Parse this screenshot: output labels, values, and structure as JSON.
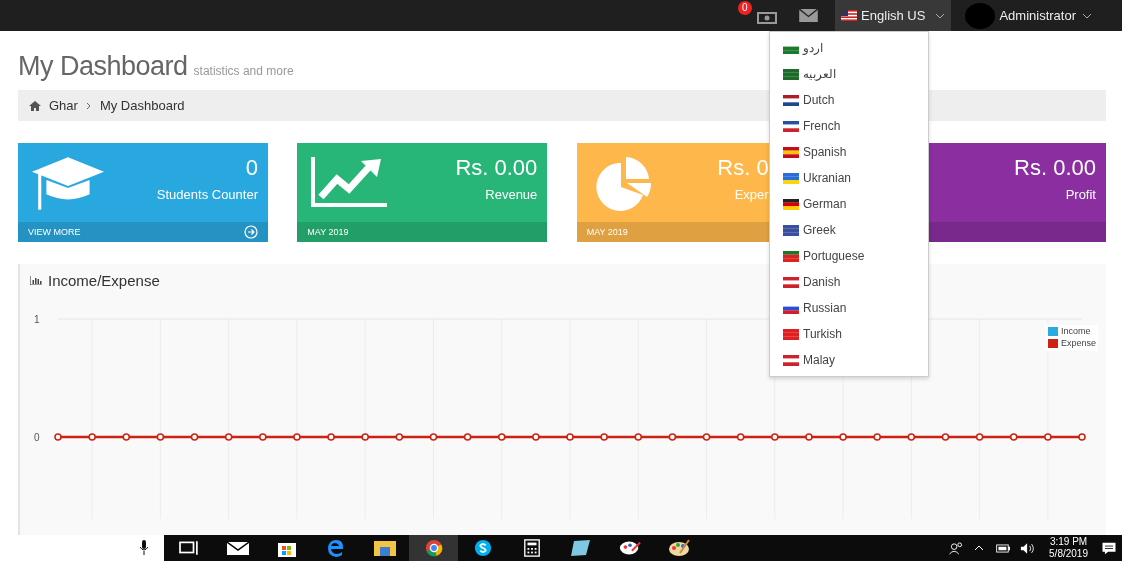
{
  "topbar": {
    "notification_count": "0",
    "language": "English US",
    "user": "Administrator"
  },
  "language_menu": [
    "اردو",
    "العربيه",
    "Dutch",
    "French",
    "Spanish",
    "Ukranian",
    "German",
    "Greek",
    "Portuguese",
    "Danish",
    "Russian",
    "Turkish",
    "Malay"
  ],
  "page": {
    "title": "My Dashboard",
    "subtitle": "statistics and more"
  },
  "breadcrumb": [
    {
      "label": "Ghar"
    },
    {
      "label": "My Dashboard"
    }
  ],
  "cards": [
    {
      "kind": "students",
      "value": "0",
      "label": "Students Counter",
      "footer": "VIEW MORE",
      "color": "#29a8e0"
    },
    {
      "kind": "revenue",
      "value": "Rs. 0.00",
      "label": "Revenue",
      "footer": "MAY 2019",
      "color": "#27b678"
    },
    {
      "kind": "expense",
      "value": "Rs. 0",
      "label": "Exper",
      "footer": "MAY 2019",
      "color": "#fdb74a"
    },
    {
      "kind": "profit",
      "value": "Rs. 0.00",
      "label": "Profit",
      "color": "#8a2ea0"
    }
  ],
  "chart": {
    "title": "Income/Expense",
    "chart_data": {
      "type": "line",
      "ylim": [
        0,
        1
      ],
      "yticks": [
        0,
        1
      ],
      "grid": true,
      "legend": "upper right",
      "series": [
        {
          "name": "Income",
          "color": "#29abe2",
          "values": [
            null,
            null,
            null,
            null,
            null,
            null,
            null,
            null,
            null,
            null,
            null,
            null,
            null,
            null,
            null,
            null,
            null,
            null,
            null,
            null,
            null,
            null,
            null,
            null,
            null,
            null,
            null,
            null,
            null,
            null,
            null
          ]
        },
        {
          "name": "Expense",
          "color": "#cc2211",
          "marker": "circle",
          "values": [
            0,
            0,
            0,
            0,
            0,
            0,
            0,
            0,
            0,
            0,
            0,
            0,
            0,
            0,
            0,
            0,
            0,
            0,
            0,
            0,
            0,
            0,
            0,
            0,
            0,
            0,
            0,
            0,
            0,
            0,
            0
          ]
        }
      ]
    }
  },
  "taskbar": {
    "time": "3:19 PM",
    "date": "5/8/2019"
  }
}
